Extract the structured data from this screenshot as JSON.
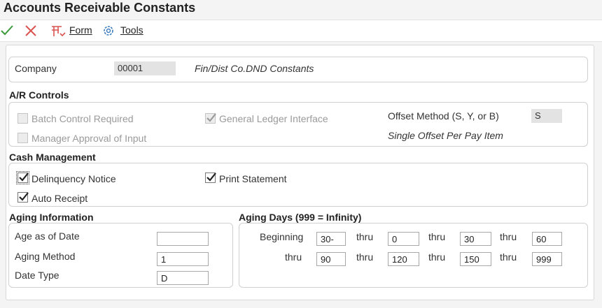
{
  "app": {
    "title": "Accounts Receivable Constants"
  },
  "toolbar": {
    "ok_icon": "check-icon",
    "cancel_icon": "x-icon",
    "form_label": "Form",
    "tools_label": "Tools"
  },
  "company": {
    "label": "Company",
    "value": "00001",
    "description": "Fin/Dist Co.DND Constants"
  },
  "ar_controls": {
    "title": "A/R Controls",
    "batch_control": {
      "label": "Batch Control Required",
      "checked": false
    },
    "manager_approval": {
      "label": "Manager Approval of Input",
      "checked": false
    },
    "gl_interface": {
      "label": "General Ledger Interface",
      "checked": true
    },
    "offset_method": {
      "label": "Offset Method (S, Y, or B)",
      "value": "S",
      "description": "Single Offset Per Pay Item"
    }
  },
  "cash_management": {
    "title": "Cash Management",
    "delinquency_notice": {
      "label": "Delinquency Notice",
      "checked": true
    },
    "print_statement": {
      "label": "Print Statement",
      "checked": true
    },
    "auto_receipt": {
      "label": "Auto Receipt",
      "checked": true
    }
  },
  "aging_information": {
    "title": "Aging Information",
    "age_as_of_date": {
      "label": "Age as of Date",
      "value": ""
    },
    "aging_method": {
      "label": "Aging Method",
      "value": "1"
    },
    "date_type": {
      "label": "Date Type",
      "value": "D"
    }
  },
  "aging_days": {
    "title": "Aging Days (999 = Infinity)",
    "beginning_label": "Beginning",
    "thru_label": "thru",
    "values": [
      "30-",
      "0",
      "30",
      "60",
      "90",
      "120",
      "150",
      "999"
    ]
  },
  "colors": {
    "accent_green": "#3c9a3c",
    "cancel_red": "#d9534f",
    "tools_blue": "#3a7bbf"
  }
}
